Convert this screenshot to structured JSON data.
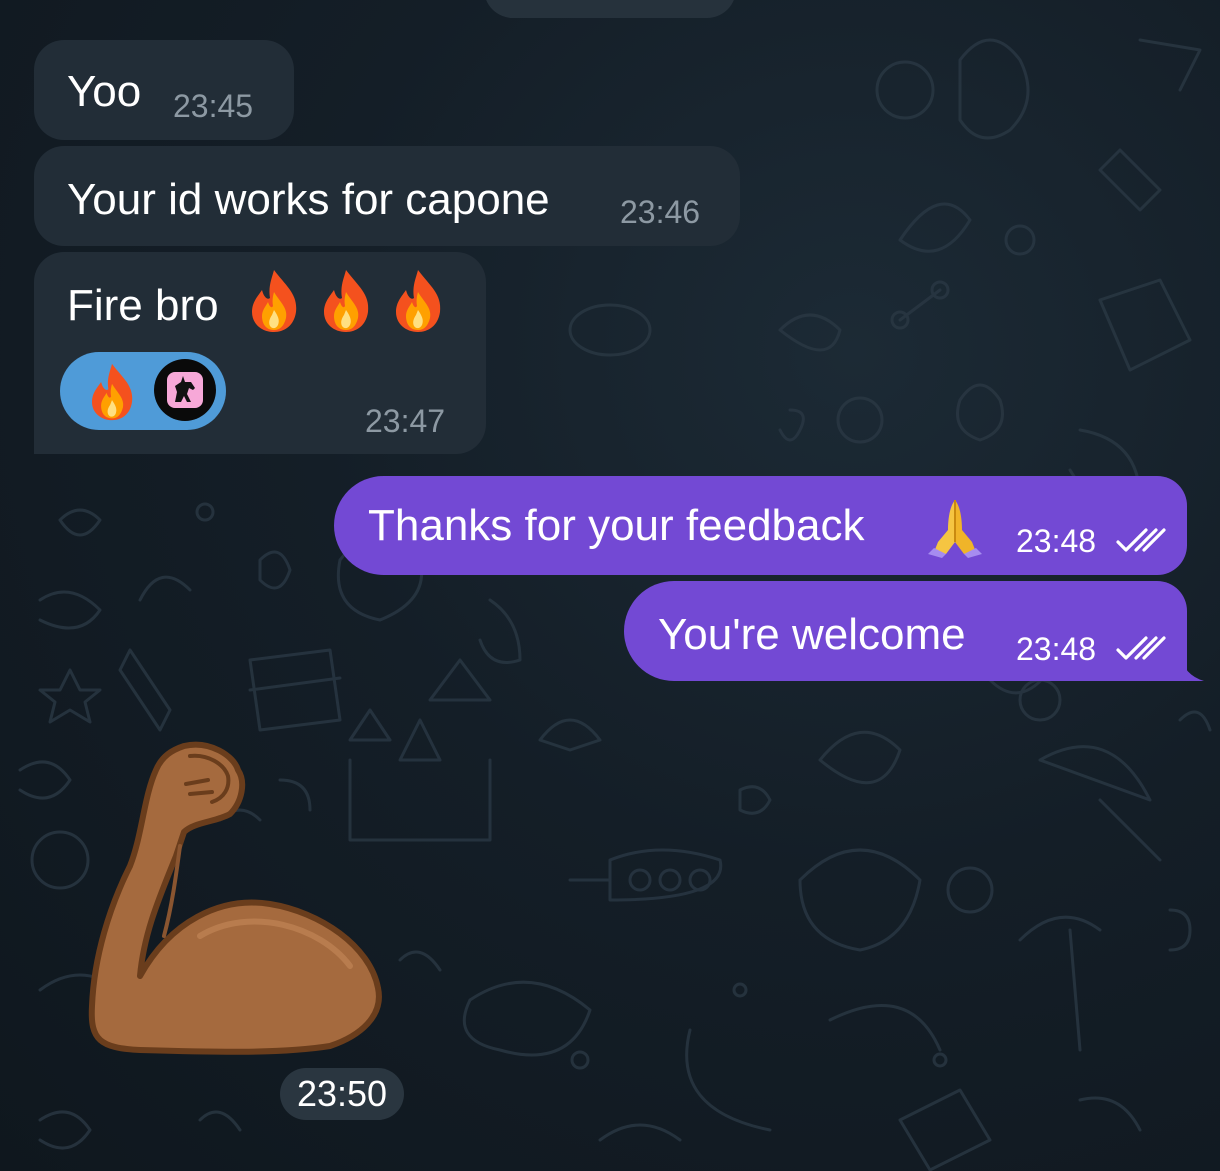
{
  "chat": {
    "messages": [
      {
        "direction": "incoming",
        "text": "Yoo",
        "time": "23:45"
      },
      {
        "direction": "incoming",
        "text": "Your id works for capone",
        "time": "23:46"
      },
      {
        "direction": "incoming",
        "text": "Fire bro",
        "emojis": [
          "🔥",
          "🔥",
          "🔥"
        ],
        "time": "23:47",
        "reaction": {
          "emoji": "🔥",
          "avatar": "unicorn-avatar-icon"
        }
      },
      {
        "direction": "outgoing",
        "text": "Thanks for your feedback",
        "emoji": "🙏",
        "time": "23:48",
        "status": "read"
      },
      {
        "direction": "outgoing",
        "text": "You're welcome",
        "time": "23:48",
        "status": "read"
      },
      {
        "direction": "incoming",
        "type": "sticker",
        "sticker": "flexed-biceps-icon",
        "time": "23:50"
      }
    ]
  },
  "colors": {
    "background": "#141e27",
    "incoming_bubble": "#222d37",
    "outgoing_bubble": "#7349d4",
    "reaction_pill": "#4f9bd8",
    "incoming_time": "#8d99a3"
  }
}
